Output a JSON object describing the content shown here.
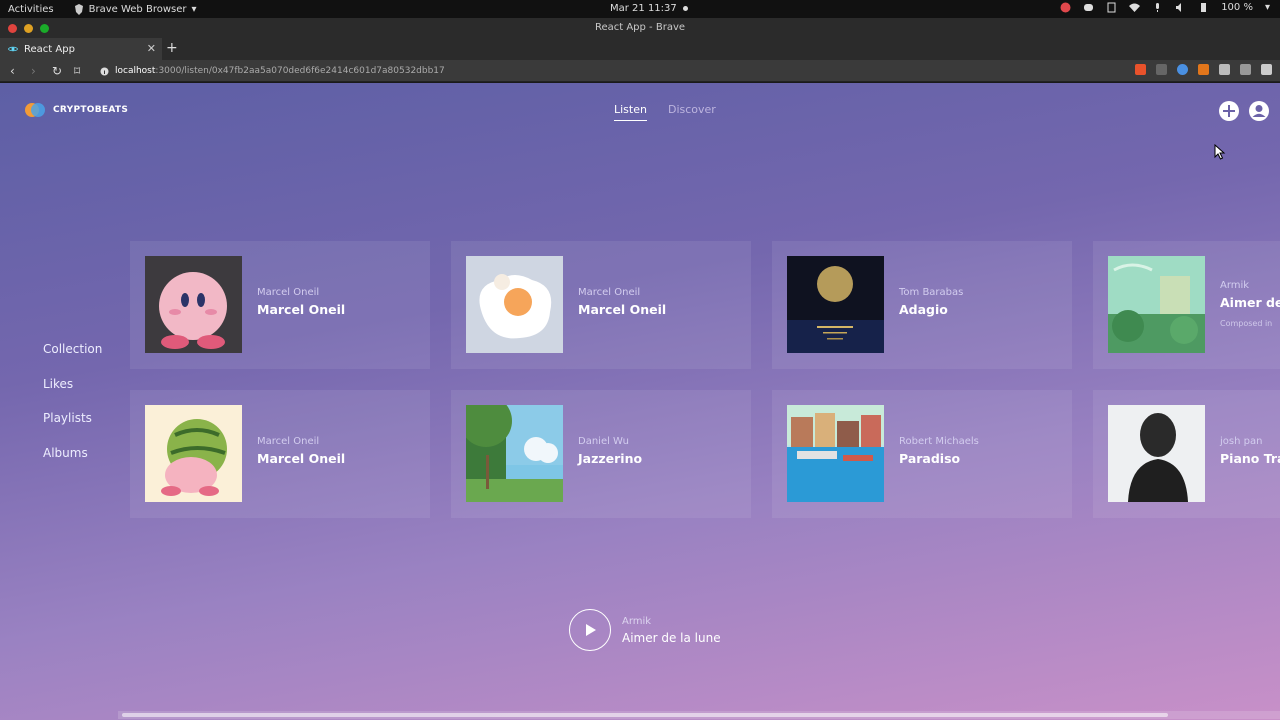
{
  "os": {
    "activities": "Activities",
    "app_name": "Brave Web Browser",
    "clock": "Mar 21  11:37",
    "battery": "100 %"
  },
  "browser": {
    "window_title": "React App - Brave",
    "tab_title": "React App",
    "url_host": "localhost",
    "url_path": ":3000/listen/0x47fb2aa5a070ded6f6e2414c601d7a80532dbb17"
  },
  "app": {
    "brand": "CRYPTOBEATS",
    "nav": [
      {
        "label": "Listen",
        "active": true
      },
      {
        "label": "Discover",
        "active": false
      }
    ],
    "sidebar": [
      "Collection",
      "Likes",
      "Playlists",
      "Albums"
    ],
    "cards_row1": [
      {
        "artist": "Marcel Oneil",
        "title": "Marcel Oneil",
        "art_icon": "pink-character-art"
      },
      {
        "artist": "Marcel Oneil",
        "title": "Marcel Oneil",
        "art_icon": "fried-egg-art"
      },
      {
        "artist": "Tom Barabas",
        "title": "Adagio",
        "art_icon": "moon-over-sea-art"
      },
      {
        "artist": "Armik",
        "title": "Aimer de",
        "subtitle": "Composed in",
        "art_icon": "green-garden-art"
      }
    ],
    "cards_row2": [
      {
        "artist": "Marcel Oneil",
        "title": "Marcel Oneil",
        "art_icon": "melon-character-art"
      },
      {
        "artist": "Daniel Wu",
        "title": "Jazzerino",
        "art_icon": "forest-landscape-art"
      },
      {
        "artist": "Robert Michaels",
        "title": "Paradiso",
        "art_icon": "harbor-town-art"
      },
      {
        "artist": "josh pan",
        "title": "Piano Tra",
        "art_icon": "bust-statue-art"
      }
    ],
    "player": {
      "artist": "Armik",
      "title": "Aimer de la lune"
    }
  },
  "colors": {
    "gradient_start": "#5d5fa5",
    "gradient_end": "#c890c8",
    "logo_orange": "#f29b38",
    "logo_blue": "#4aa3e8"
  }
}
